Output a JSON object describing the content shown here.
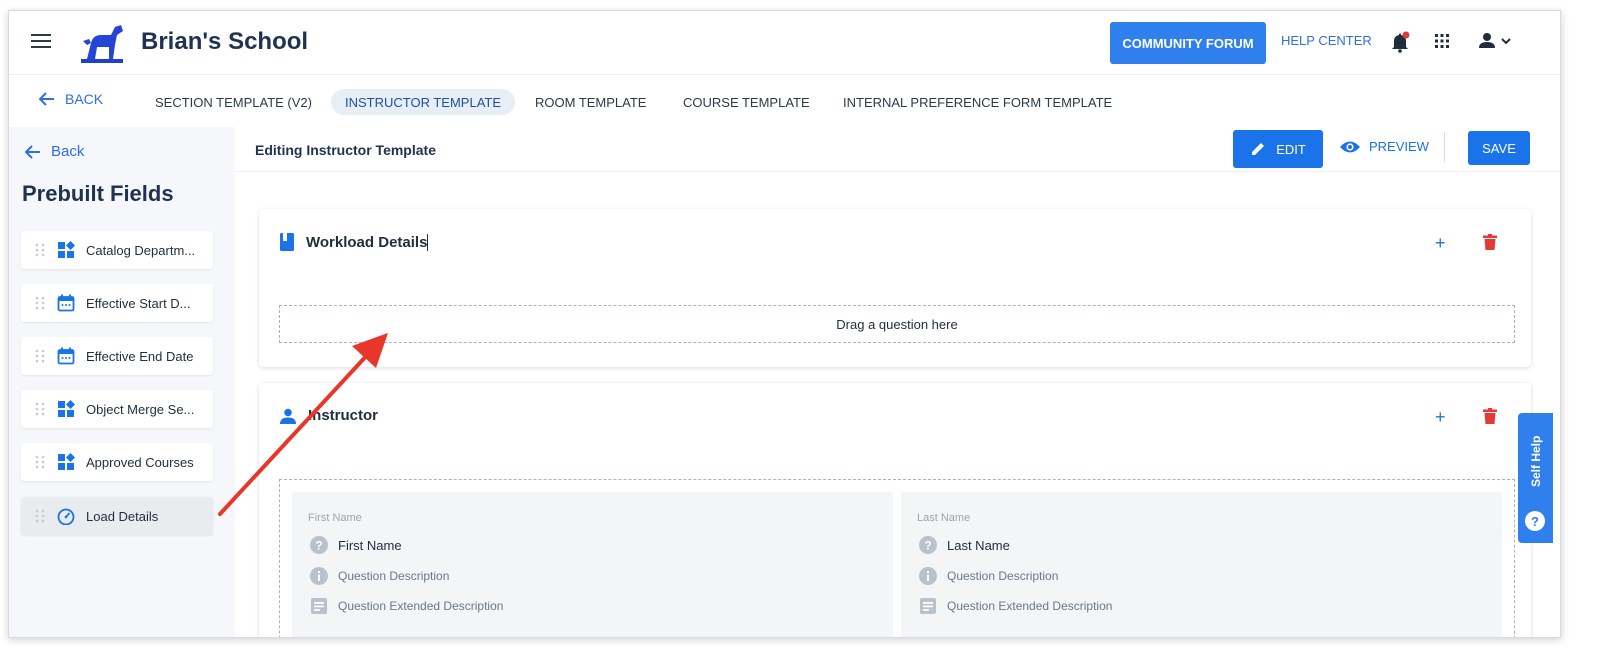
{
  "header": {
    "school_name": "Brian's School",
    "community_forum": "COMMUNITY FORUM",
    "help_center": "HELP CENTER"
  },
  "tabs": {
    "back": "BACK",
    "items": [
      {
        "label": "SECTION TEMPLATE (V2)",
        "active": false
      },
      {
        "label": "INSTRUCTOR TEMPLATE",
        "active": true
      },
      {
        "label": "ROOM TEMPLATE",
        "active": false
      },
      {
        "label": "COURSE TEMPLATE",
        "active": false
      },
      {
        "label": "INTERNAL PREFERENCE FORM TEMPLATE",
        "active": false
      }
    ]
  },
  "sidebar": {
    "back": "Back",
    "title": "Prebuilt Fields",
    "fields": [
      {
        "label": "Catalog Departm...",
        "icon": "widgets-icon"
      },
      {
        "label": "Effective Start D...",
        "icon": "calendar-icon"
      },
      {
        "label": "Effective End Date",
        "icon": "calendar-icon"
      },
      {
        "label": "Object Merge Se...",
        "icon": "widgets-icon"
      },
      {
        "label": "Approved Courses",
        "icon": "widgets-icon"
      },
      {
        "label": "Load Details",
        "icon": "speedometer-icon"
      }
    ]
  },
  "toolbar": {
    "title": "Editing Instructor Template",
    "edit": "EDIT",
    "preview": "PREVIEW",
    "save": "SAVE"
  },
  "sections": {
    "workload": {
      "title": "Workload Details",
      "drop_text": "Drag a question here"
    },
    "instructor": {
      "title": "Instructor",
      "questions": [
        {
          "small_label": "First Name",
          "name": "First Name",
          "description": "Question Description",
          "extended": "Question Extended Description"
        },
        {
          "small_label": "Last Name",
          "name": "Last Name",
          "description": "Question Description",
          "extended": "Question Extended Description"
        }
      ]
    }
  },
  "self_help": "Self Help",
  "colors": {
    "primary": "#1a73e8",
    "community": "#2f80ed",
    "danger": "#e53935",
    "annotation_arrow": "#e8362a"
  }
}
